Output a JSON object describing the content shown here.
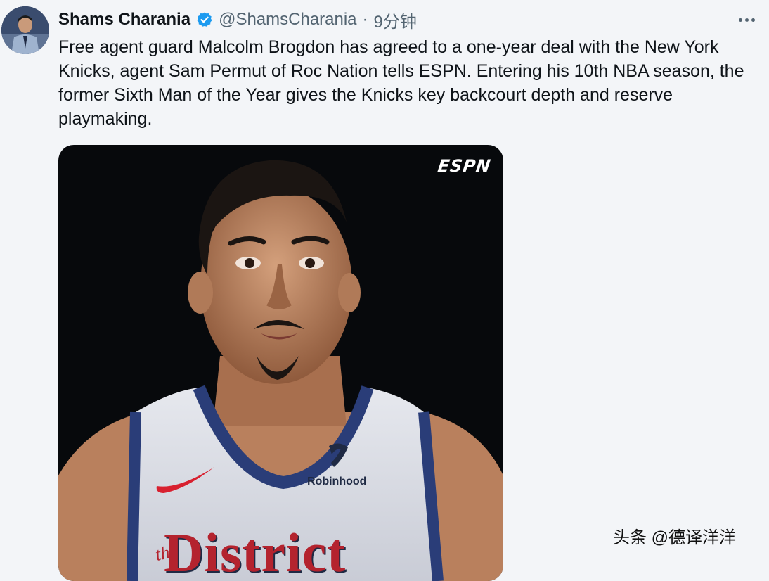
{
  "tweet": {
    "author_name": "Shams Charania",
    "handle": "@ShamsCharania",
    "separator": "·",
    "time": "9分钟",
    "text": "Free agent guard Malcolm Brogdon has agreed to a one-year deal with the New York Knicks, agent Sam Permut of Roc Nation tells ESPN. Entering his 10th NBA season, the former Sixth Man of the Year gives the Knicks key backcourt depth and reserve playmaking."
  },
  "media": {
    "network_logo": "ESPN",
    "jersey_sponsor": "Robinhood",
    "jersey_small": "the",
    "jersey_text": "District"
  },
  "watermark": "头条 @德译洋洋",
  "icons": {
    "verified": "verified-badge-icon",
    "more": "more-options-icon"
  },
  "colors": {
    "verified_blue": "#1d9bf0",
    "text_primary": "#0f1419",
    "text_secondary": "#536471",
    "background": "#f3f5f8"
  }
}
